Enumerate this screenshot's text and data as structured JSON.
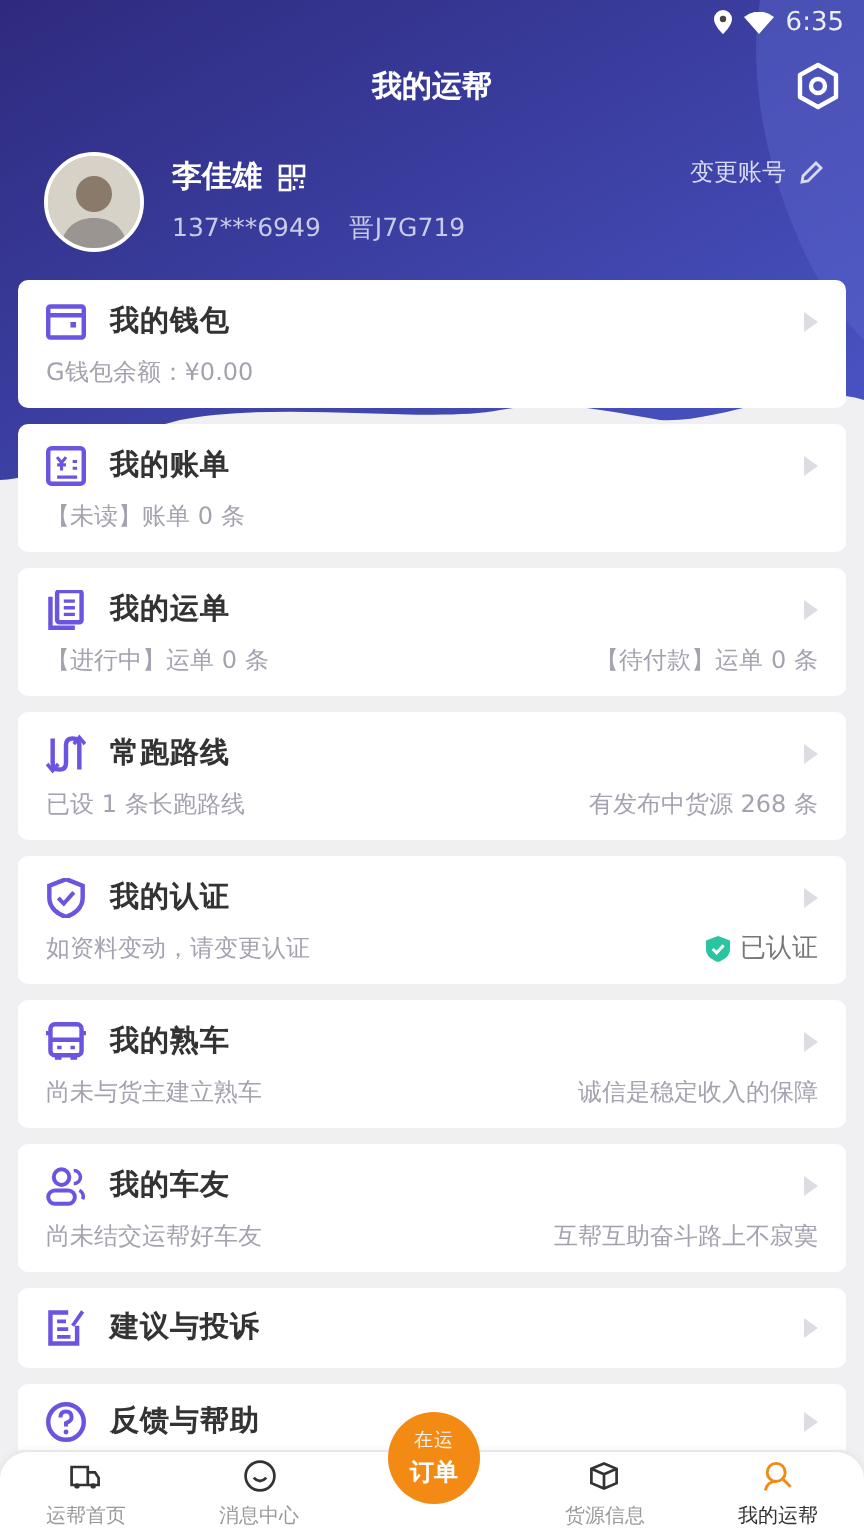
{
  "status_bar": {
    "time": "6:35"
  },
  "header": {
    "title": "我的运帮"
  },
  "profile": {
    "name": "李佳雄",
    "phone": "137***6949",
    "plate": "晋J7G719",
    "switch_account": "变更账号"
  },
  "cards": [
    {
      "kind": "detail",
      "title": "我的钱包",
      "left": "G钱包余额：¥0.00"
    },
    {
      "kind": "detail",
      "title": "我的账单",
      "left": "【未读】账单 0 条"
    },
    {
      "kind": "detail",
      "title": "我的运单",
      "left": "【进行中】运单 0 条",
      "right": "【待付款】运单 0 条"
    },
    {
      "kind": "detail",
      "title": "常跑路线",
      "left": "已设 1 条长跑路线",
      "right": "有发布中货源 268 条"
    },
    {
      "kind": "detail",
      "title": "我的认证",
      "left": "如资料变动，请变更认证",
      "right": "已认证",
      "verified": true
    },
    {
      "kind": "detail",
      "title": "我的熟车",
      "left": "尚未与货主建立熟车",
      "right": "诚信是稳定收入的保障"
    },
    {
      "kind": "detail",
      "title": "我的车友",
      "left": "尚未结交运帮好车友",
      "right": "互帮互助奋斗路上不寂寞"
    },
    {
      "kind": "plain",
      "title": "建议与投诉"
    },
    {
      "kind": "plain",
      "title": "反馈与帮助"
    }
  ],
  "order_button": {
    "lines": [
      "在运",
      "订单"
    ]
  },
  "tab_bar": [
    {
      "label": "运帮首页",
      "selected": false
    },
    {
      "label": "消息中心",
      "selected": false
    },
    {
      "label": "货源信息",
      "selected": false
    },
    {
      "label": "我的运帮",
      "selected": true
    }
  ]
}
